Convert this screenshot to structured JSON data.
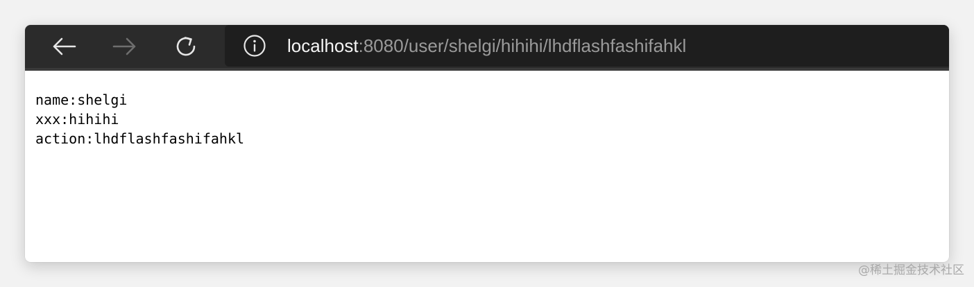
{
  "browser": {
    "toolbar": {
      "back_icon": "arrow-left-icon",
      "forward_icon": "arrow-right-icon",
      "reload_icon": "reload-icon",
      "info_icon": "info-circle-icon"
    },
    "address_bar": {
      "host": "localhost",
      "rest": ":8080/user/shelgi/hihihi/lhdflashfashifahkl"
    }
  },
  "page": {
    "lines": [
      "name:shelgi",
      "xxx:hihihi",
      "action:lhdflashfashifahkl"
    ]
  },
  "watermark": {
    "text": "@稀土掘金技术社区"
  },
  "colors": {
    "toolbar_bg": "#2b2b2b",
    "address_bg": "#1e1e1e",
    "url_host": "#f5f5f5",
    "url_rest": "#9a9a9a"
  }
}
